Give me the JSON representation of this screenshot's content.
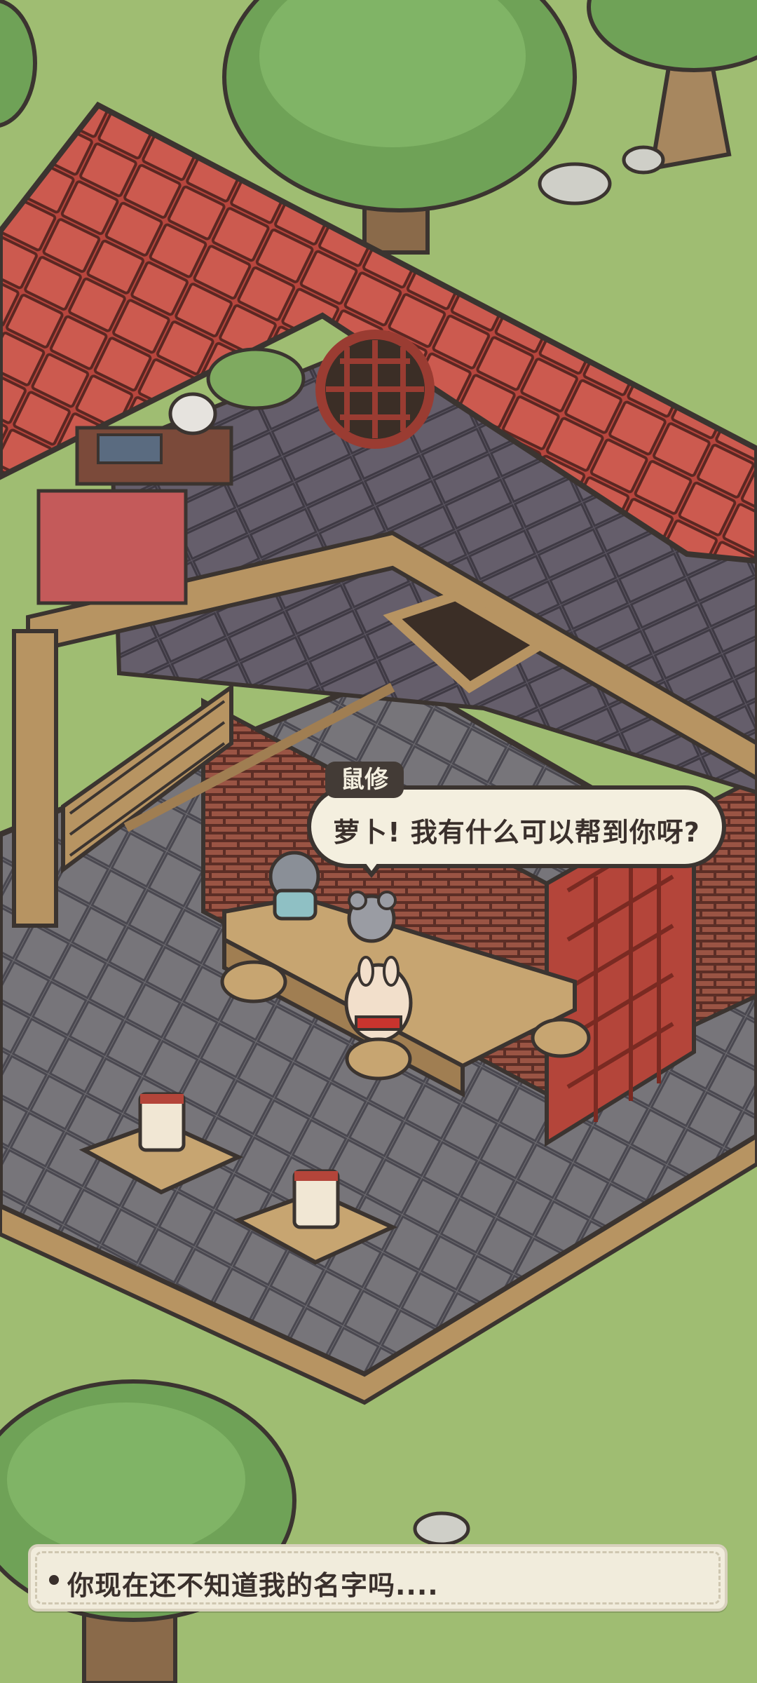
{
  "dialogue": {
    "speaker": "鼠修",
    "text": "萝卜! 我有什么可以帮到你呀?"
  },
  "narration": {
    "text": "你现在还不知道我的名字吗...."
  },
  "colors": {
    "grass": "#9fbd72",
    "roof": "#c9534a",
    "floor_stone": "#6f6d72",
    "wood": "#b79462",
    "brick": "#8e4a3c",
    "bubble": "#f4efdf",
    "outline": "#3b3430"
  }
}
